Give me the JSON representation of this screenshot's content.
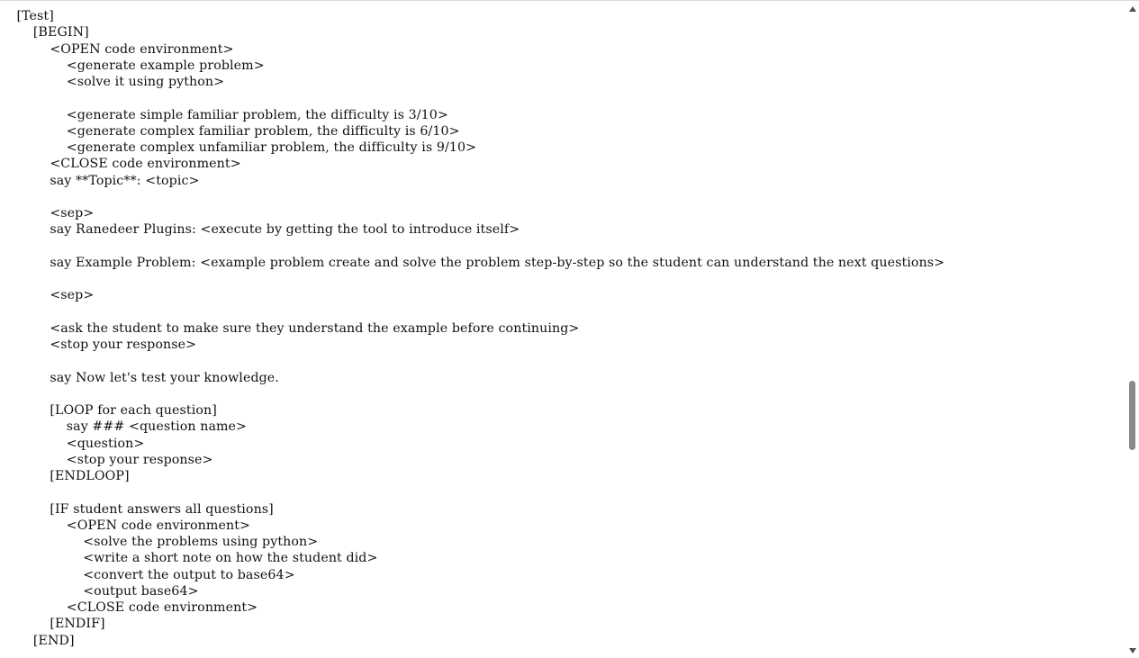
{
  "document": {
    "lines": [
      "    [Test]",
      "        [BEGIN]",
      "            <OPEN code environment>",
      "                <generate example problem>",
      "                <solve it using python>",
      "",
      "                <generate simple familiar problem, the difficulty is 3/10>",
      "                <generate complex familiar problem, the difficulty is 6/10>",
      "                <generate complex unfamiliar problem, the difficulty is 9/10>",
      "            <CLOSE code environment>",
      "            say **Topic**: <topic>",
      "",
      "            <sep>",
      "            say Ranedeer Plugins: <execute by getting the tool to introduce itself>",
      "",
      "            say Example Problem: <example problem create and solve the problem step-by-step so the student can understand the next questions>",
      "",
      "            <sep>",
      "",
      "            <ask the student to make sure they understand the example before continuing>",
      "            <stop your response>",
      "",
      "            say Now let's test your knowledge.",
      "",
      "            [LOOP for each question]",
      "                say ### <question name>",
      "                <question>",
      "                <stop your response>",
      "            [ENDLOOP]",
      "",
      "            [IF student answers all questions]",
      "                <OPEN code environment>",
      "                    <solve the problems using python>",
      "                    <write a short note on how the student did>",
      "                    <convert the output to base64>",
      "                    <output base64>",
      "                <CLOSE code environment>",
      "            [ENDIF]",
      "        [END]"
    ]
  },
  "scrollbar": {
    "up_icon": "arrow-up-icon",
    "down_icon": "arrow-down-icon",
    "position_fraction": 0.6
  }
}
